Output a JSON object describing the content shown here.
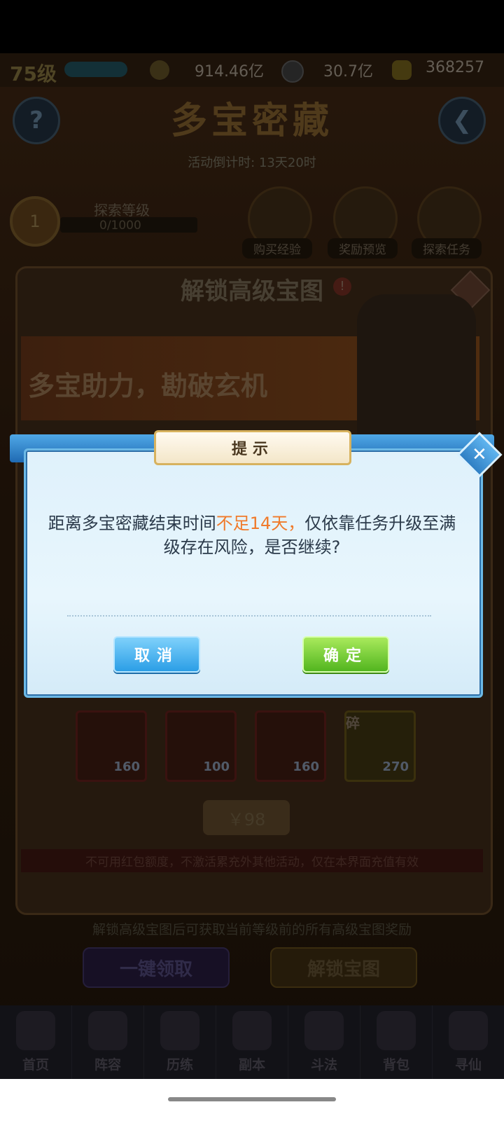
{
  "resources": {
    "level": "75级",
    "currency1": "914.46亿",
    "currency2": "30.7亿",
    "currency3": "368257"
  },
  "header": {
    "help": "?",
    "title": "多宝密藏",
    "countdown": "活动倒计时: 13天20时"
  },
  "explore": {
    "level_num": "1",
    "label": "探索等级",
    "progress": "0/1000",
    "buttons": [
      "购买经验",
      "奖励预览",
      "探索任务"
    ]
  },
  "panel": {
    "title": "解锁高级宝图",
    "banner": "多宝助力，勘破玄机",
    "items": [
      {
        "qty": "160",
        "icon": "golden-orb-icon"
      },
      {
        "qty": "100",
        "icon": "potion-bottle-icon"
      },
      {
        "qty": "160",
        "icon": "red-stone-icon"
      },
      {
        "qty": "270",
        "icon": "fragment-icon",
        "tag": "碎"
      }
    ],
    "price": "￥98",
    "note": "不可用红包额度，不激活累充外其他活动，仅在本界面充值有效"
  },
  "footer": {
    "note": "解锁高级宝图后可获取当前等级前的所有高级宝图奖励",
    "claim_all": "一键领取",
    "unlock": "解锁宝图"
  },
  "nav": [
    "首页",
    "阵容",
    "历练",
    "副本",
    "斗法",
    "背包",
    "寻仙"
  ],
  "dialog": {
    "title": "提示",
    "msg_part1": "距离多宝密藏结束时间",
    "msg_warn": "不足14天，",
    "msg_part2": "仅依靠任务升级至满级存在风险，是否继续?",
    "cancel": "取消",
    "confirm": "确定"
  },
  "colors": {
    "warn": "#f07a2a",
    "cancel_btn": "#2b9ee6",
    "confirm_btn": "#52b51f"
  }
}
